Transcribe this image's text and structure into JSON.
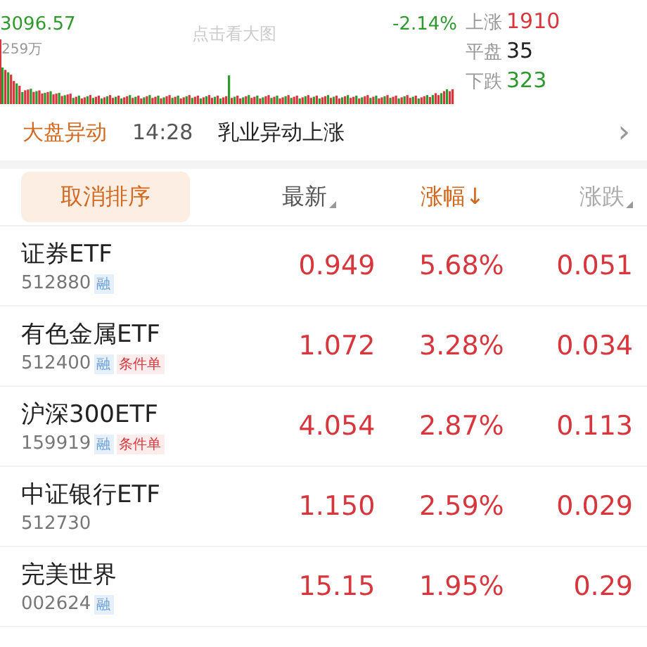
{
  "chart": {
    "price": "3096.57",
    "change": "-2.14%",
    "hint": "点击看大图",
    "volume": "259万"
  },
  "breadth": [
    {
      "label": "上涨",
      "value": "1910",
      "color": "#d8363d"
    },
    {
      "label": "平盘",
      "value": "35",
      "color": "#222222"
    },
    {
      "label": "下跌",
      "value": "323",
      "color": "#2e9a2e"
    }
  ],
  "alert": {
    "tag": "大盘异动",
    "time": "14:28",
    "text": "乳业异动上涨",
    "chevron": "›"
  },
  "table": {
    "sort_button": "取消排序",
    "columns": [
      {
        "label": "最新",
        "sorted": false,
        "sortable": true
      },
      {
        "label": "涨幅↓",
        "sorted": true,
        "sortable": false
      },
      {
        "label": "涨跌",
        "sorted": false,
        "sortable": true
      }
    ],
    "rows": [
      {
        "name": "证券ETF",
        "code": "512880",
        "badges": [
          {
            "kind": "margin",
            "text": "融"
          }
        ],
        "price": "0.949",
        "pct": "5.68%",
        "chg": "0.051"
      },
      {
        "name": "有色金属ETF",
        "code": "512400",
        "badges": [
          {
            "kind": "margin",
            "text": "融"
          },
          {
            "kind": "conditional",
            "text": "条件单"
          }
        ],
        "price": "1.072",
        "pct": "3.28%",
        "chg": "0.034"
      },
      {
        "name": "沪深300ETF",
        "code": "159919",
        "badges": [
          {
            "kind": "margin",
            "text": "融"
          },
          {
            "kind": "conditional",
            "text": "条件单"
          }
        ],
        "price": "4.054",
        "pct": "2.87%",
        "chg": "0.113"
      },
      {
        "name": "中证银行ETF",
        "code": "512730",
        "badges": [],
        "price": "1.150",
        "pct": "2.59%",
        "chg": "0.029"
      },
      {
        "name": "完美世界",
        "code": "002624",
        "badges": [
          {
            "kind": "margin",
            "text": "融"
          }
        ],
        "price": "15.15",
        "pct": "1.95%",
        "chg": "0.29"
      }
    ]
  }
}
